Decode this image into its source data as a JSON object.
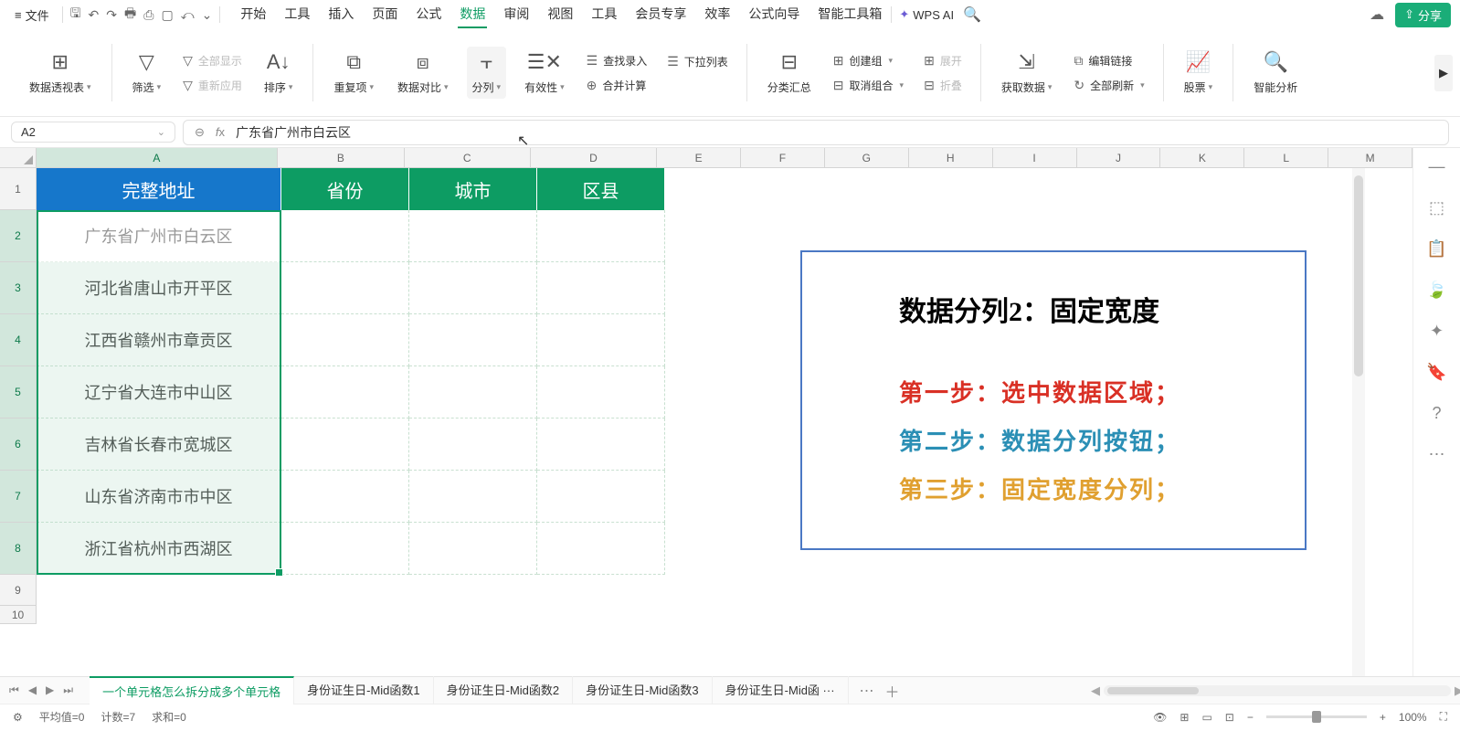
{
  "menu": {
    "file": "文件",
    "tabs": [
      "开始",
      "工具",
      "插入",
      "页面",
      "公式",
      "数据",
      "审阅",
      "视图",
      "工具",
      "会员专享",
      "效率",
      "公式向导",
      "智能工具箱"
    ],
    "active_tab": 5,
    "wps_ai": "WPS AI",
    "share": "分享"
  },
  "ribbon": {
    "pivot": "数据透视表",
    "filter": "筛选",
    "show_all": "全部显示",
    "reapply": "重新应用",
    "sort": "排序",
    "dup": "重复项",
    "compare": "数据对比",
    "split": "分列",
    "validate": "有效性",
    "find_entry": "查找录入",
    "merge_calc": "合并计算",
    "dropdown_list": "下拉列表",
    "subtotal": "分类汇总",
    "group_create": "创建组",
    "group_cancel": "取消组合",
    "expand": "展开",
    "collapse": "折叠",
    "get_data": "获取数据",
    "edit_link": "编辑链接",
    "refresh_all": "全部刷新",
    "stocks": "股票",
    "smart_analyze": "智能分析"
  },
  "namebox": {
    "value": "A2"
  },
  "formula": {
    "value": "广东省广州市白云区"
  },
  "columns": [
    "A",
    "B",
    "C",
    "D",
    "E",
    "F",
    "G",
    "H",
    "I",
    "J",
    "K",
    "L",
    "M"
  ],
  "headers": {
    "a": "完整地址",
    "b": "省份",
    "c": "城市",
    "d": "区县"
  },
  "rows": [
    "广东省广州市白云区",
    "河北省唐山市开平区",
    "江西省赣州市章贡区",
    "辽宁省大连市中山区",
    "吉林省长春市宽城区",
    "山东省济南市市中区",
    "浙江省杭州市西湖区"
  ],
  "info": {
    "title": "数据分列2：固定宽度",
    "step1": "第一步：选中数据区域；",
    "step2": "第二步：数据分列按钮；",
    "step3": "第三步：固定宽度分列；"
  },
  "sheets": {
    "active": "一个单元格怎么拆分成多个单元格",
    "others": [
      "身份证生日-Mid函数1",
      "身份证生日-Mid函数2",
      "身份证生日-Mid函数3",
      "身份证生日-Mid函 ···"
    ]
  },
  "status": {
    "avg": "平均值=0",
    "count": "计数=7",
    "sum": "求和=0",
    "zoom": "100%"
  }
}
